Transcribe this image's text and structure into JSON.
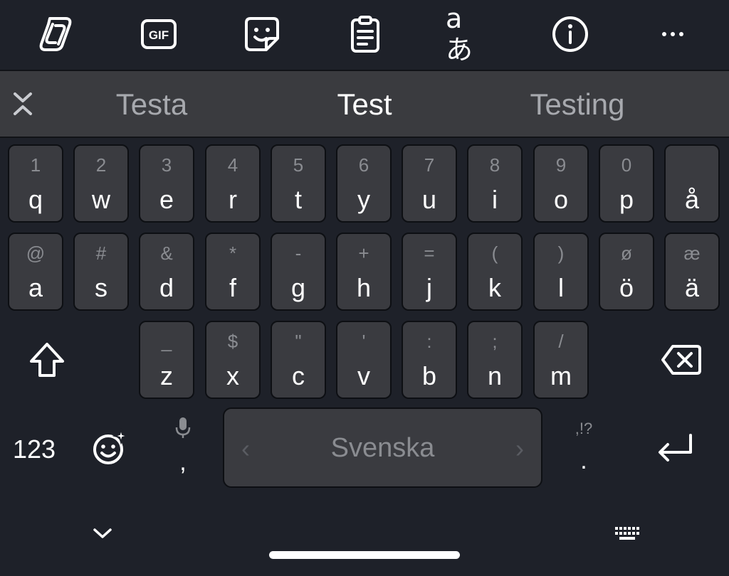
{
  "toolbar": {
    "buttons": [
      {
        "icon": "copilot-icon"
      },
      {
        "icon": "gif-icon",
        "label": "GIF"
      },
      {
        "icon": "sticker-icon"
      },
      {
        "icon": "clipboard-icon"
      },
      {
        "icon": "translate-icon",
        "label": "aあ"
      },
      {
        "icon": "info-icon"
      },
      {
        "icon": "more-icon",
        "label": "···"
      }
    ]
  },
  "suggestions": {
    "left": "Testa",
    "middle": "Test",
    "right": "Testing"
  },
  "keyboard": {
    "row1": [
      {
        "hint": "1",
        "key": "q"
      },
      {
        "hint": "2",
        "key": "w"
      },
      {
        "hint": "3",
        "key": "e"
      },
      {
        "hint": "4",
        "key": "r"
      },
      {
        "hint": "5",
        "key": "t"
      },
      {
        "hint": "6",
        "key": "y"
      },
      {
        "hint": "7",
        "key": "u"
      },
      {
        "hint": "8",
        "key": "i"
      },
      {
        "hint": "9",
        "key": "o"
      },
      {
        "hint": "0",
        "key": "p"
      },
      {
        "hint": "",
        "key": "å"
      }
    ],
    "row2": [
      {
        "hint": "@",
        "key": "a"
      },
      {
        "hint": "#",
        "key": "s"
      },
      {
        "hint": "&",
        "key": "d"
      },
      {
        "hint": "*",
        "key": "f"
      },
      {
        "hint": "-",
        "key": "g"
      },
      {
        "hint": "+",
        "key": "h"
      },
      {
        "hint": "=",
        "key": "j"
      },
      {
        "hint": "(",
        "key": "k"
      },
      {
        "hint": ")",
        "key": "l"
      },
      {
        "hint": "ø",
        "key": "ö"
      },
      {
        "hint": "æ",
        "key": "ä"
      }
    ],
    "row3": [
      {
        "hint": "_",
        "key": "z"
      },
      {
        "hint": "$",
        "key": "x"
      },
      {
        "hint": "\"",
        "key": "c"
      },
      {
        "hint": "'",
        "key": "v"
      },
      {
        "hint": ":",
        "key": "b"
      },
      {
        "hint": ";",
        "key": "n"
      },
      {
        "hint": "/",
        "key": "m"
      }
    ],
    "bottom": {
      "numbers_label": "123",
      "comma": ",",
      "space_label": "Svenska",
      "space_left_arrow": "‹",
      "space_right_arrow": "›",
      "punct_hint": ",!?",
      "period": "."
    }
  },
  "colors": {
    "background": "#1e2129",
    "key": "#3a3b40",
    "suggestion_bar": "#3a3b3f",
    "hint_text": "#8a8c91"
  }
}
